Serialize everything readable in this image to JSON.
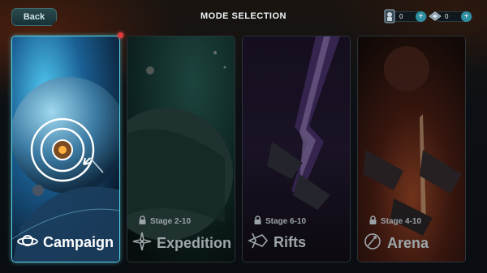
{
  "header": {
    "back_label": "Back",
    "title": "MODE SELECTION"
  },
  "currencies": [
    {
      "icon": "soldier-card-icon",
      "value": "0"
    },
    {
      "icon": "starship-icon",
      "value": "0"
    }
  ],
  "modes": [
    {
      "name": "Campaign",
      "icon": "planet-ring-icon",
      "stage": "",
      "locked": false,
      "selected": true
    },
    {
      "name": "Expedition",
      "icon": "compass-star-icon",
      "stage": "Stage 2-10",
      "locked": true,
      "selected": false
    },
    {
      "name": "Rifts",
      "icon": "rift-ship-icon",
      "stage": "Stage 6-10",
      "locked": true,
      "selected": false
    },
    {
      "name": "Arena",
      "icon": "arena-shield-icon",
      "stage": "Stage 4-10",
      "locked": true,
      "selected": false
    }
  ],
  "colors": {
    "accent": "#58d6e8",
    "notification": "#e23a3a"
  }
}
